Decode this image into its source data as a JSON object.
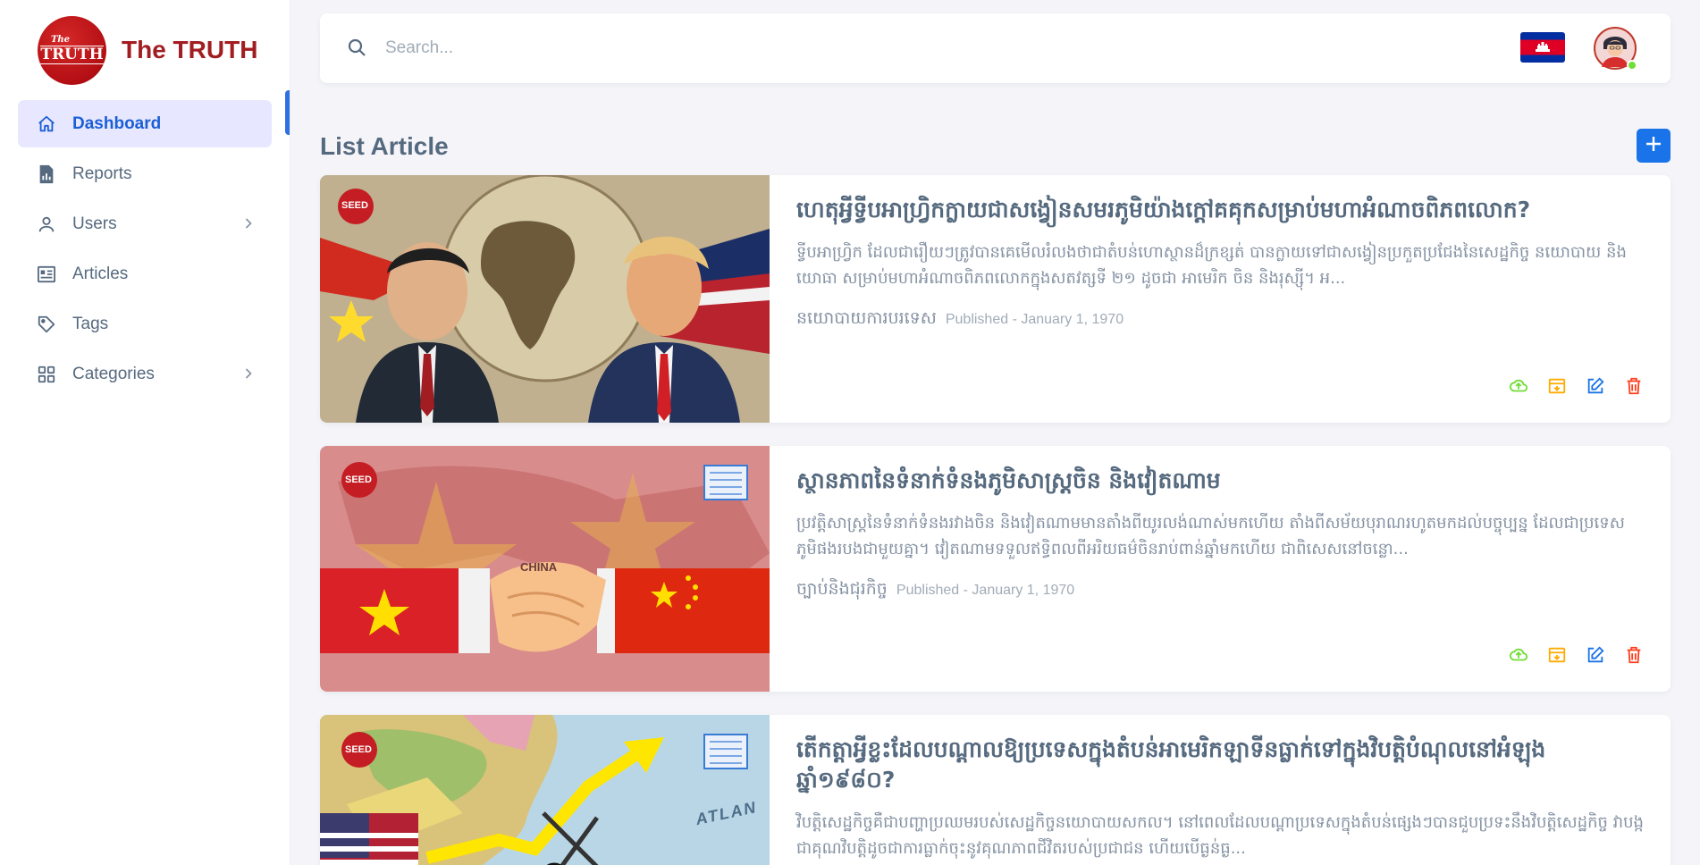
{
  "brand": {
    "logo_small": "The",
    "logo_big": "TRUTH",
    "name": "The TRUTH"
  },
  "sidebar": {
    "items": [
      {
        "label": "Dashboard",
        "icon": "home-icon",
        "active": true
      },
      {
        "label": "Reports",
        "icon": "file-report-icon"
      },
      {
        "label": "Users",
        "icon": "user-icon",
        "has_submenu": true
      },
      {
        "label": "Articles",
        "icon": "article-icon"
      },
      {
        "label": "Tags",
        "icon": "tag-icon"
      },
      {
        "label": "Categories",
        "icon": "grid-icon",
        "has_submenu": true
      }
    ]
  },
  "topbar": {
    "search_placeholder": "Search..."
  },
  "main": {
    "title": "List Article",
    "articles": [
      {
        "title": "ហេតុអ្វីទ្វីបអាហ្វ្រិកក្លាយជាសង្វៀនសមរភូមិយ៉ាងក្ដៅគគុកសម្រាប់មហាអំណាចពិភពលោក?",
        "desc": "ទ្វីបអាហ្វ្រិក ដែលជារឿយៗត្រូវបានគេមើលរំលងថាជាតំបន់ហោស្ថានដ៏ក្រខ្សត់ បានក្លាយទៅជាសង្វៀនប្រកួតប្រជែងនៃសេដ្ឋកិច្ច នយោបាយ និងយោធា សម្រាប់មហាអំណាចពិភពលោកក្នុងសតវត្សទី ២១ ដូចជា អាមេរិក ចិន និងរុស្ស៊ី។ អ...",
        "category": "នយោបាយការបរទេស",
        "published": "Published - January 1, 1970",
        "image_badge": "SEED"
      },
      {
        "title": "ស្ថានភាពនៃទំនាក់ទំនងភូមិសាស្ត្រចិន និងវៀតណាម",
        "desc": "ប្រវត្តិសាស្ត្រនៃទំនាក់ទំនងរវាងចិន និងវៀតណាមមានតាំងពីយូរលង់ណាស់មកហើយ តាំងពីសម័យបុរាណរហូតមកដល់បច្ចុប្បន្ន ដែលជាប្រទេសភូមិផងរបងជាមួយគ្នា។ វៀតណាមទទួលឥទ្ធិពលពីអរិយធម៌ចិនរាប់ពាន់ឆ្នាំមកហើយ ជាពិសេសនៅចន្លោ...",
        "category": "ច្បាប់និងជុរកិច្ច",
        "published": "Published - January 1, 1970",
        "image_badge": "SEED",
        "image_label": "CHINA"
      },
      {
        "title": "តើកត្តាអ្វីខ្លះដែលបណ្ដាលឱ្យប្រទេសក្នុងតំបន់អាមេរិកឡាទីនធ្លាក់ទៅក្នុងវិបត្តិបំណុលនៅអំឡុងឆ្នាំ១៩៨០?",
        "desc": "វិបត្តិសេដ្ឋកិច្ចគឺជាបញ្ហាប្រឈមរបស់សេដ្ឋកិច្ចនយោបាយសកល។ នៅពេលដែលបណ្ដាប្រទេសក្នុងតំបន់ផ្សេងៗបានជួបប្រទះនឹងវិបត្តិសេដ្ឋកិច្ច វាបង្កជាគុណវិបត្តិដូចជាការធ្លាក់ចុះនូវគុណភាពជីវិតរបស់ប្រជាជន ហើយបើធ្ងន់ធ្ង...",
        "image_badge": "SEED",
        "image_label": "ATLAN"
      }
    ]
  },
  "colors": {
    "brand": "#a11d22",
    "primary": "#1a73e8",
    "active_bg": "#e7e7ff",
    "publish": "#71dd37",
    "archive": "#ffab00",
    "edit": "#1a73e8",
    "delete": "#ff3e1d"
  }
}
